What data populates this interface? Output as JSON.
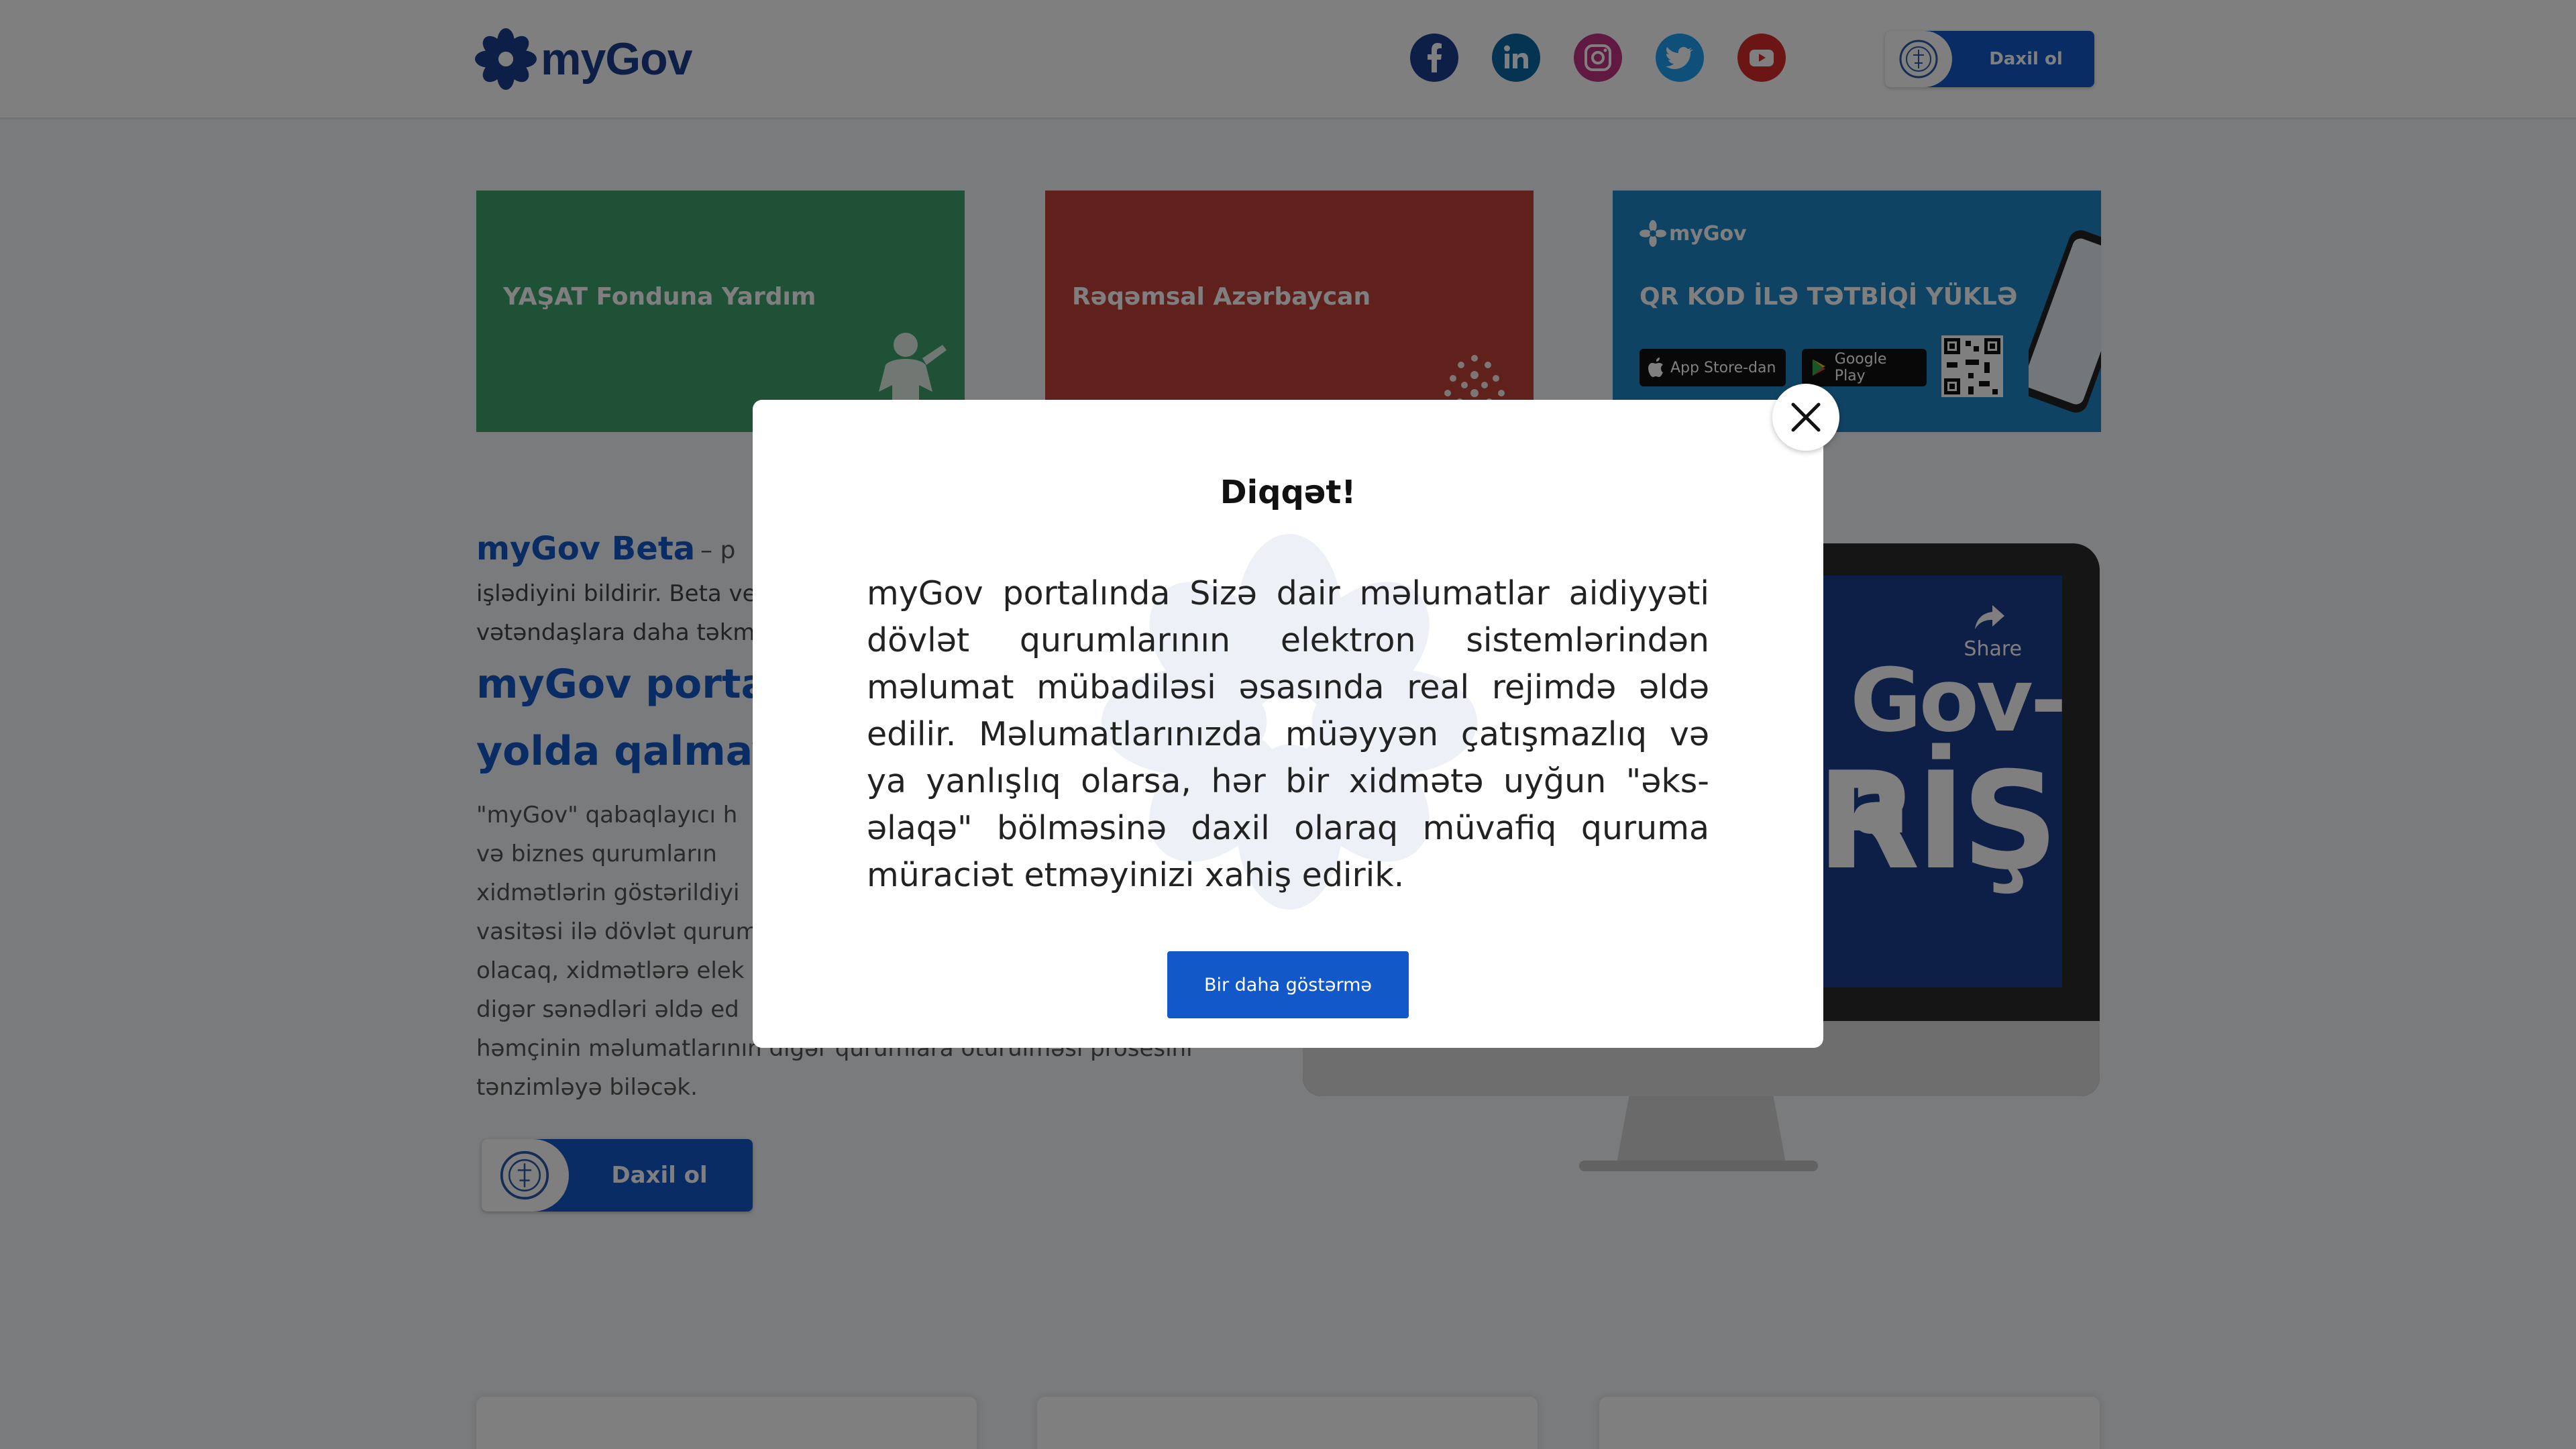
{
  "header": {
    "logo_text": "myGov",
    "social": [
      {
        "name": "facebook-icon",
        "color": "#1d3f8f"
      },
      {
        "name": "linkedin-icon",
        "color": "#0b66a4"
      },
      {
        "name": "instagram-icon",
        "color": "#c13584"
      },
      {
        "name": "twitter-icon",
        "color": "#1da1f2"
      },
      {
        "name": "youtube-icon",
        "color": "#d62b2b"
      }
    ],
    "login_label": "Daxil ol"
  },
  "cards": [
    {
      "title": "YAŞAT Fonduna Yardım",
      "color": "#3fa36d"
    },
    {
      "title": "Rəqəmsal Azərbaycan",
      "color": "#c0433b"
    },
    {
      "title": "QR KOD İLƏ TƏTBİQİ YÜKLƏ",
      "color": "#1f86c6",
      "mini_logo": "myGov",
      "app_store": "App Store-dan",
      "google_play": "Google Play"
    }
  ],
  "content": {
    "beta_title": "myGov Beta",
    "beta_dash": "– p",
    "beta_line2": "işlədiyini bildirir. Beta ve",
    "beta_line3": "vətəndaşlara daha təkm",
    "big_title_1": "myGov portalı",
    "big_title_2": "yolda qalmaya",
    "para_lines": [
      "\"myGov\" qabaqlayıcı h",
      "və biznes qurumların",
      "xidmətlərin göstərildiyi",
      "vasitəsi ilə dövlət qurum",
      "olacaq, xidmətlərə elek",
      "digər sənədləri əldə ed",
      "həmçinin məlumatlarının digər qurumlara ötürülməsi prosesini",
      "tənzimləyə biləcək."
    ],
    "login_label": "Daxil ol"
  },
  "video": {
    "share_label": "Share",
    "text_1": "Gov-a",
    "text_2": "RİŞ"
  },
  "modal": {
    "title": "Diqqət!",
    "body": "myGov portalında Sizə dair məlumatlar aidiyyəti dövlət qurumlarının elektron sistemlərindən məlumat mübadiləsi əsasında real rejimdə əldə edilir. Məlumatlarınızda müəyyən çatışmazlıq və ya yanlışlıq olarsa, hər bir xidmətə uyğun \"əks-əlaqə\" bölməsinə daxil olaraq müvafiq quruma müraciət etməyinizi xahiş edirik.",
    "button_label": "Bir daha göstərmə"
  }
}
